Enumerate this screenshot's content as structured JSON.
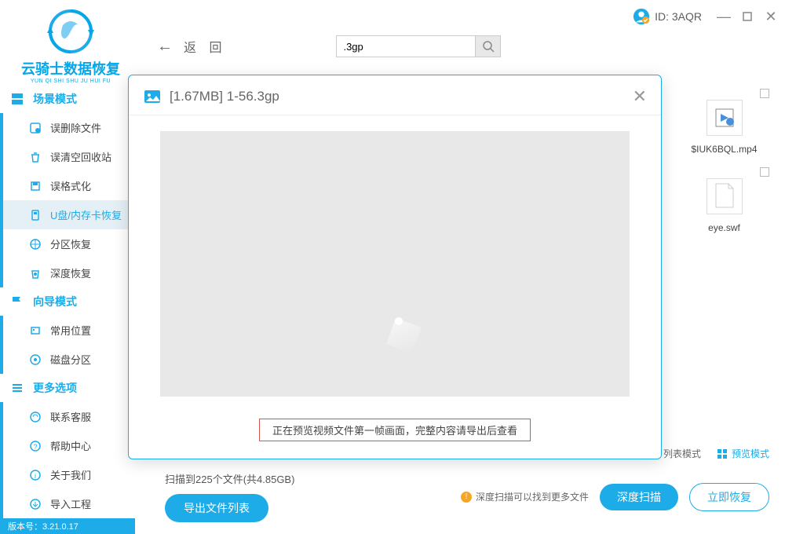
{
  "header": {
    "id_label": "ID: 3AQR"
  },
  "logo": {
    "title": "云骑士数据恢复",
    "subtitle": "YUN QI SHI SHU JU HUI FU"
  },
  "toolbar": {
    "back_label": "返 回",
    "search_value": ".3gp"
  },
  "sidebar": {
    "section1": "场景模式",
    "items1": [
      "误删除文件",
      "误清空回收站",
      "误格式化",
      "U盘/内存卡恢复",
      "分区恢复",
      "深度恢复"
    ],
    "section2": "向导模式",
    "items2": [
      "常用位置",
      "磁盘分区"
    ],
    "section3": "更多选项",
    "items3": [
      "联系客服",
      "帮助中心",
      "关于我们",
      "导入工程"
    ]
  },
  "files": [
    {
      "name": "$IUK6BQL.mp4"
    },
    {
      "name": "eye.swf"
    }
  ],
  "view": {
    "list": "列表模式",
    "preview": "预览模式"
  },
  "status": {
    "scan_text": "扫描到225个文件(共4.85GB)",
    "export_btn": "导出文件列表",
    "tip": "深度扫描可以找到更多文件",
    "deep_scan": "深度扫描",
    "recover": "立即恢复"
  },
  "version": "版本号：3.21.0.17",
  "modal": {
    "title": "[1.67MB] 1-56.3gp",
    "message": "正在预览视频文件第一帧画面，完整内容请导出后查看"
  }
}
